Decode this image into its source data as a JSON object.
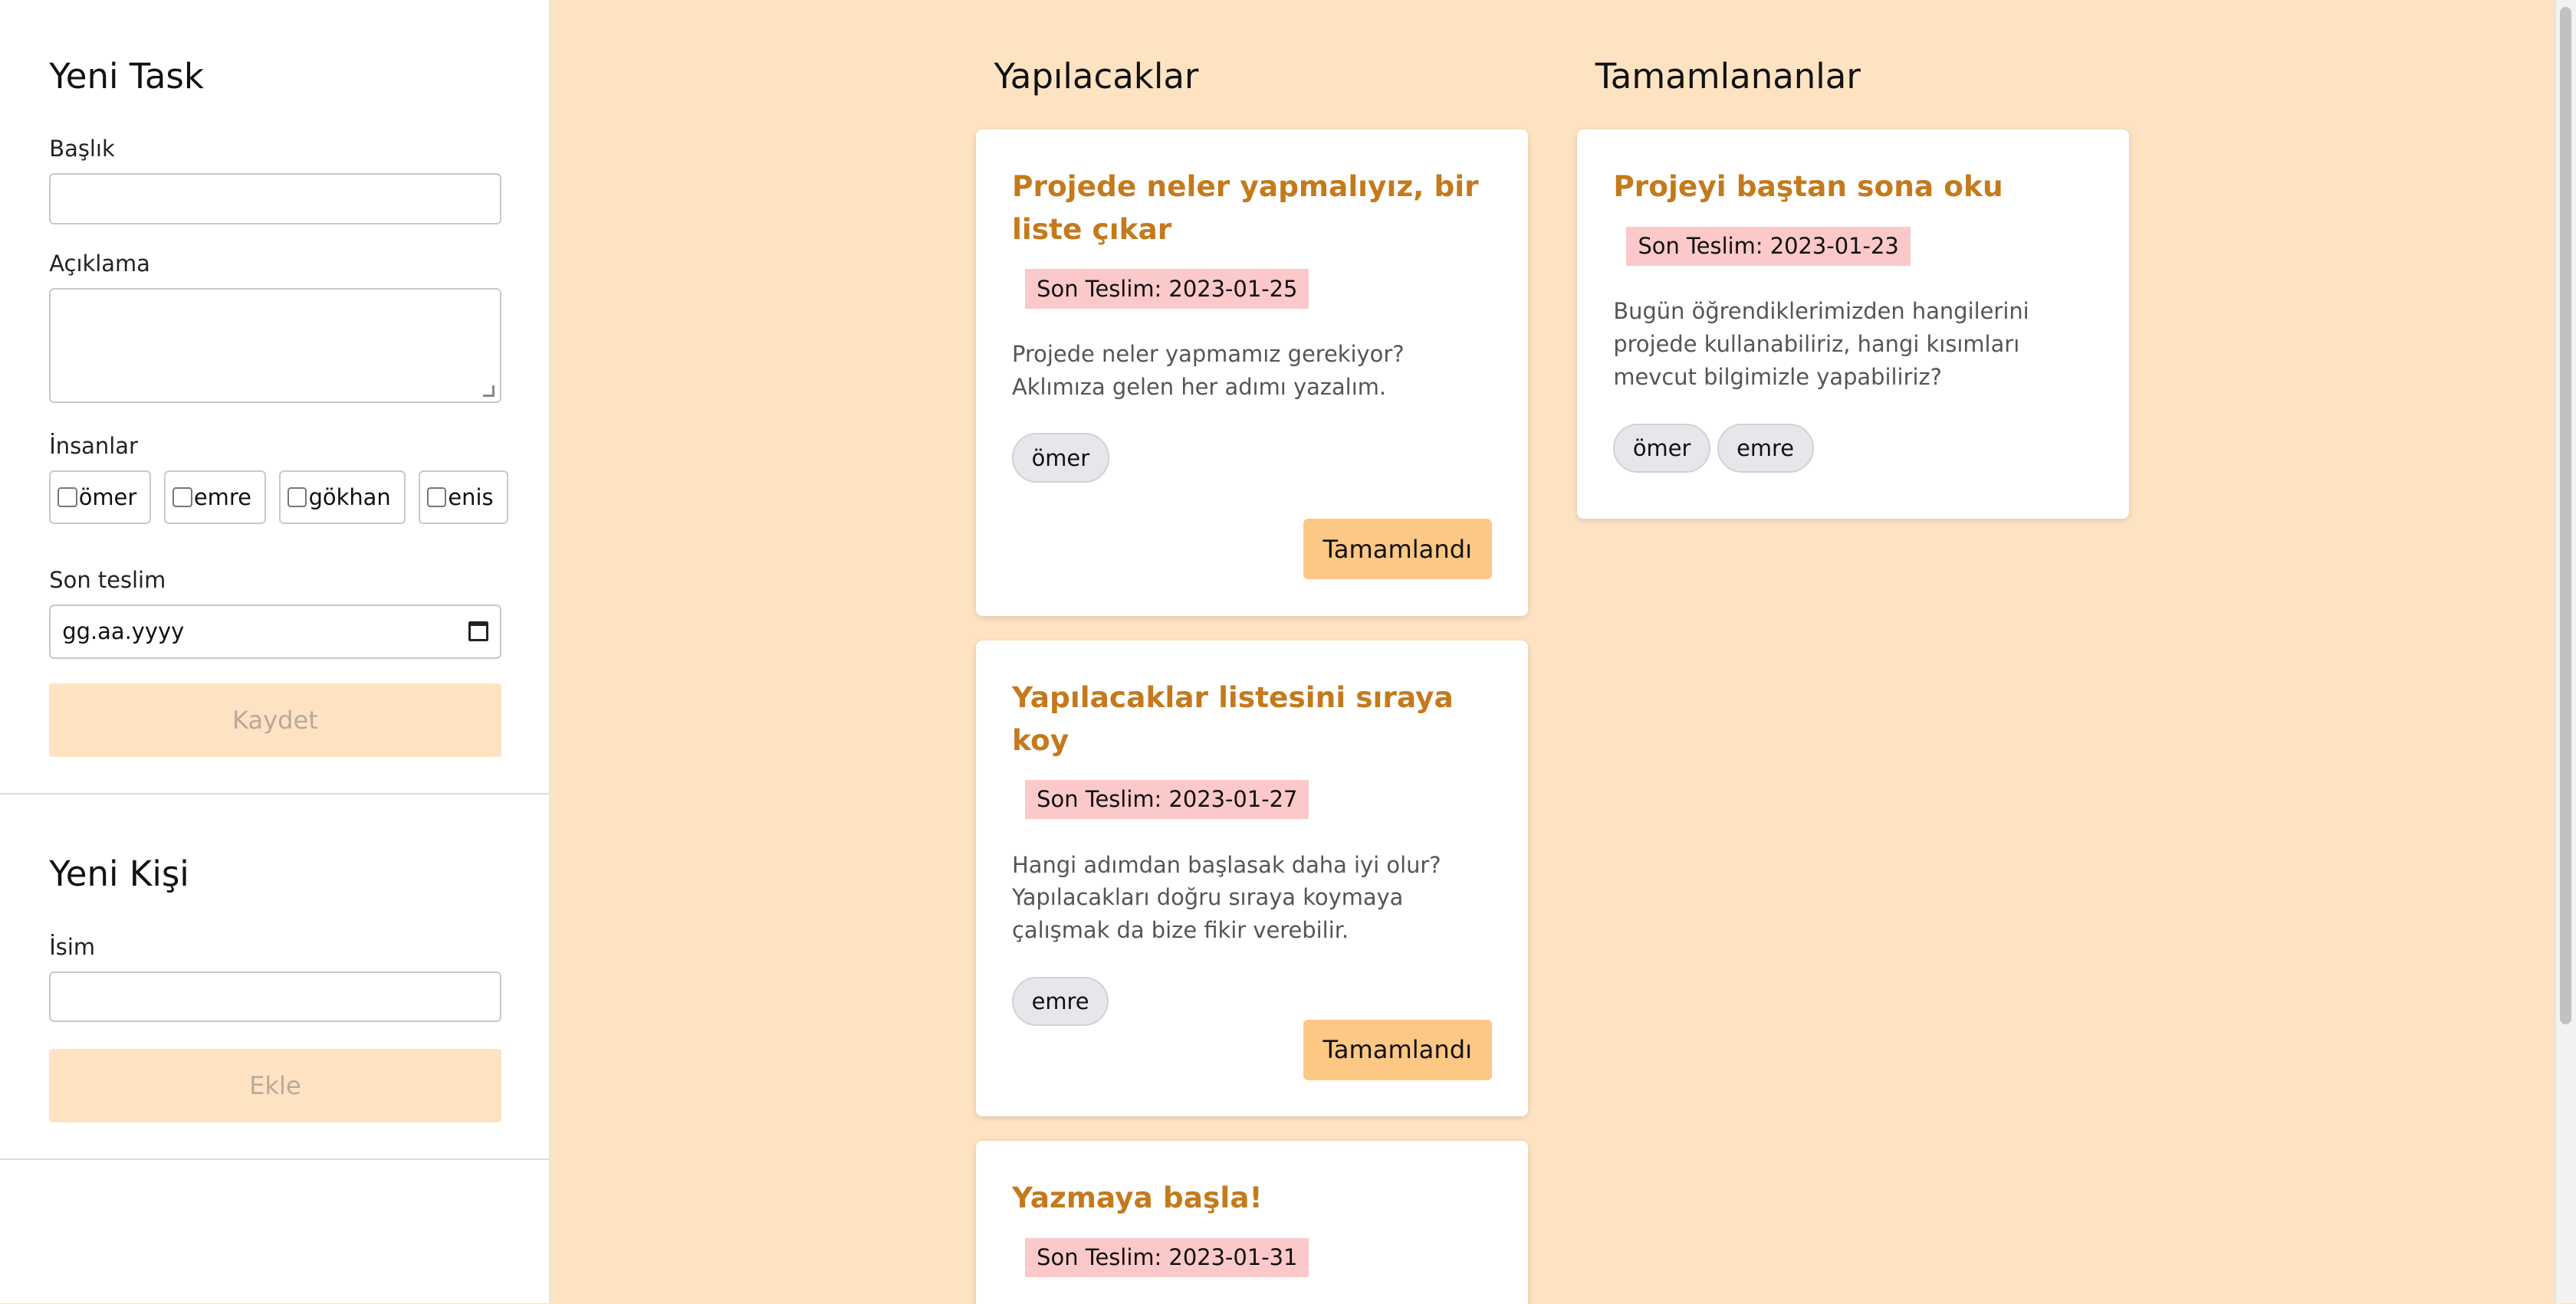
{
  "new_task": {
    "heading": "Yeni Task",
    "title_label": "Başlık",
    "title_value": "",
    "description_label": "Açıklama",
    "description_value": "",
    "people_label": "İnsanlar",
    "people": [
      "ömer",
      "emre",
      "gökhan",
      "enis"
    ],
    "due_label": "Son teslim",
    "due_placeholder": "gg.aa.yyyy",
    "save_button": "Kaydet"
  },
  "new_person": {
    "heading": "Yeni Kişi",
    "name_label": "İsim",
    "name_value": "",
    "add_button": "Ekle"
  },
  "todo": {
    "heading": "Yapılacaklar",
    "done_button": "Tamamlandı",
    "cards": [
      {
        "title": "Projede neler yapmalıyız, bir liste çıkar",
        "due": "Son Teslim: 2023-01-25",
        "description": "Projede neler yapmamız gerekiyor? Aklımıza gelen her adımı yazalım.",
        "people": [
          "ömer"
        ]
      },
      {
        "title": "Yapılacaklar listesini sıraya koy",
        "due": "Son Teslim: 2023-01-27",
        "description": "Hangi adımdan başlasak daha iyi olur? Yapılacakları doğru sıraya koymaya çalışmak da bize fikir verebilir.",
        "people": [
          "emre"
        ]
      },
      {
        "title": "Yazmaya başla!",
        "due": "Son Teslim: 2023-01-31"
      }
    ]
  },
  "done": {
    "heading": "Tamamlananlar",
    "cards": [
      {
        "title": "Projeyi baştan sona oku",
        "due": "Son Teslim: 2023-01-23",
        "description": "Bugün öğrendiklerimizden hangilerini projede kullanabiliriz, hangi kısımları mevcut bilgimizle yapabiliriz?",
        "people": [
          "ömer",
          "emre"
        ]
      }
    ]
  },
  "colors": {
    "background": "#fde3c2",
    "card_title": "#c47a1c",
    "due_badge": "#fbc9c9",
    "done_button": "#fdc784",
    "disabled_button": "#fde3c2"
  }
}
